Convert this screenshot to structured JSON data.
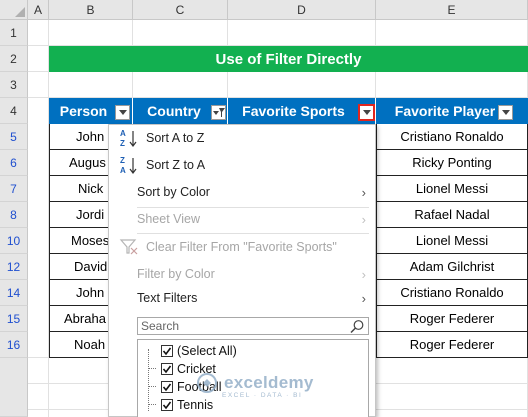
{
  "columns": [
    "A",
    "B",
    "C",
    "D",
    "E"
  ],
  "rows": [
    "1",
    "2",
    "3",
    "4",
    "5",
    "6",
    "7",
    "8",
    "10",
    "12",
    "14",
    "15",
    "16"
  ],
  "title": "Use of Filter Directly",
  "headers": {
    "person": "Person",
    "country": "Country",
    "sports": "Favorite Sports",
    "player": "Favorite Player"
  },
  "persons": [
    "John",
    "Augus",
    "Nick",
    "Jordi",
    "Moses",
    "David",
    "John",
    "Abraha",
    "Noah"
  ],
  "players": [
    "Cristiano Ronaldo",
    "Ricky Ponting",
    "Lionel Messi",
    "Rafael Nadal",
    "Lionel Messi",
    "Adam Gilchrist",
    "Cristiano Ronaldo",
    "Roger Federer",
    "Roger Federer"
  ],
  "menu": {
    "sort_az": "Sort A to Z",
    "sort_za": "Sort Z to A",
    "sort_by_color": "Sort by Color",
    "sheet_view": "Sheet View",
    "clear_filter": "Clear Filter From \"Favorite Sports\"",
    "filter_by_color": "Filter by Color",
    "text_filters": "Text Filters",
    "search_placeholder": "Search",
    "items": [
      "(Select All)",
      "Cricket",
      "Football",
      "Tennis"
    ]
  },
  "watermark": {
    "name": "exceldemy",
    "tagline": "EXCEL · DATA · BI"
  },
  "colors": {
    "banner": "#12b050",
    "header": "#0070c0",
    "active_dropdown_border": "#e0261f",
    "filtered_row_number": "#1f4fcf"
  },
  "icons": [
    "sort-az-icon",
    "sort-za-icon",
    "clear-filter-icon",
    "search-icon",
    "filter-dropdown-icon",
    "chevron-right-icon"
  ]
}
